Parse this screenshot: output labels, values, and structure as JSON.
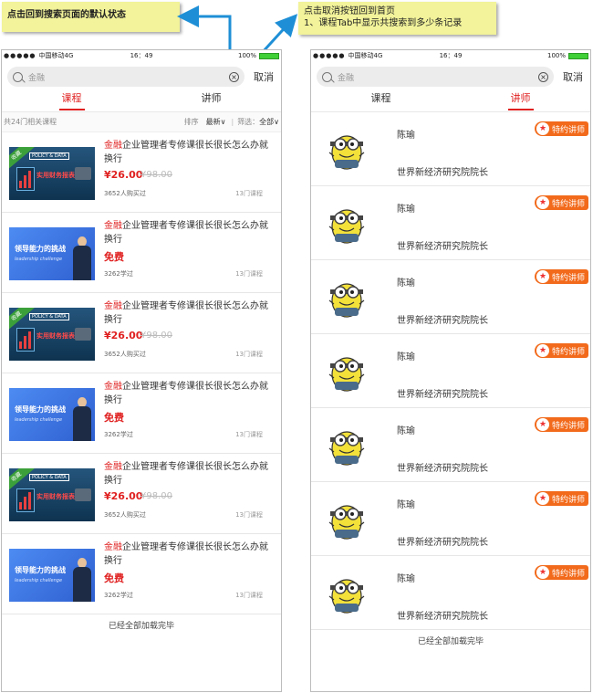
{
  "notes": {
    "left": "点击回到搜索页面的默认状态",
    "right_line1": "点击取消按钮回到首页",
    "right_line2": "1、课程Tab中显示共搜索到多少条记录"
  },
  "status": {
    "signal": "●●●●●",
    "carrier": "中国移动4G",
    "time": "16：49",
    "battery": "100%"
  },
  "search": {
    "query": "金融",
    "clear": "×",
    "cancel": "取消"
  },
  "tabs": [
    "课程",
    "讲师"
  ],
  "filter": {
    "total": "共24门相关课程",
    "sort_label": "排序",
    "sort_value": "最新∨",
    "sep": "|",
    "filter_label": "筛选：",
    "filter_value": "全部∨"
  },
  "courses": [
    {
      "hl": "金融",
      "rest": "企业管理者专修课很长很长怎么办就换行",
      "price": "¥26.00",
      "orig": "¥98.00",
      "buyers": "3652人购买过",
      "count": "13门课程",
      "thumb": "dark"
    },
    {
      "hl": "金融",
      "rest": "企业管理者专修课很长很长怎么办就换行",
      "price": "免费",
      "orig": "",
      "buyers": "3262学过",
      "count": "13门课程",
      "thumb": "blue"
    },
    {
      "hl": "金融",
      "rest": "企业管理者专修课很长很长怎么办就换行",
      "price": "¥26.00",
      "orig": "¥98.00",
      "buyers": "3652人购买过",
      "count": "13门课程",
      "thumb": "dark"
    },
    {
      "hl": "金融",
      "rest": "企业管理者专修课很长很长怎么办就换行",
      "price": "免费",
      "orig": "",
      "buyers": "3262学过",
      "count": "13门课程",
      "thumb": "blue"
    },
    {
      "hl": "金融",
      "rest": "企业管理者专修课很长很长怎么办就换行",
      "price": "¥26.00",
      "orig": "¥98.00",
      "buyers": "3652人购买过",
      "count": "13门课程",
      "thumb": "dark"
    },
    {
      "hl": "金融",
      "rest": "企业管理者专修课很长很长怎么办就换行",
      "price": "免费",
      "orig": "",
      "buyers": "3262学过",
      "count": "13门课程",
      "thumb": "blue"
    }
  ],
  "thumb_text": {
    "dark_ribbon": "收藏",
    "dark_tag": "POLICY & DATA",
    "dark_title": "实用财务报表",
    "blue_title": "领导能力的挑战",
    "blue_sub": "leadership challenge"
  },
  "footer": "已经全部加载完毕",
  "lecturers": [
    {
      "name": "陈瑜",
      "org": "世界新经济研究院院长",
      "badge": "特约讲师"
    },
    {
      "name": "陈瑜",
      "org": "世界新经济研究院院长",
      "badge": "特约讲师"
    },
    {
      "name": "陈瑜",
      "org": "世界新经济研究院院长",
      "badge": "特约讲师"
    },
    {
      "name": "陈瑜",
      "org": "世界新经济研究院院长",
      "badge": "特约讲师"
    },
    {
      "name": "陈瑜",
      "org": "世界新经济研究院院长",
      "badge": "特约讲师"
    },
    {
      "name": "陈瑜",
      "org": "世界新经济研究院院长",
      "badge": "特约讲师"
    },
    {
      "name": "陈瑜",
      "org": "世界新经济研究院院长",
      "badge": "特约讲师"
    }
  ],
  "colors": {
    "accent": "#e02020",
    "note_bg": "#f2f39a",
    "arrow": "#1e8fd6",
    "badge": "#f26a1b"
  }
}
